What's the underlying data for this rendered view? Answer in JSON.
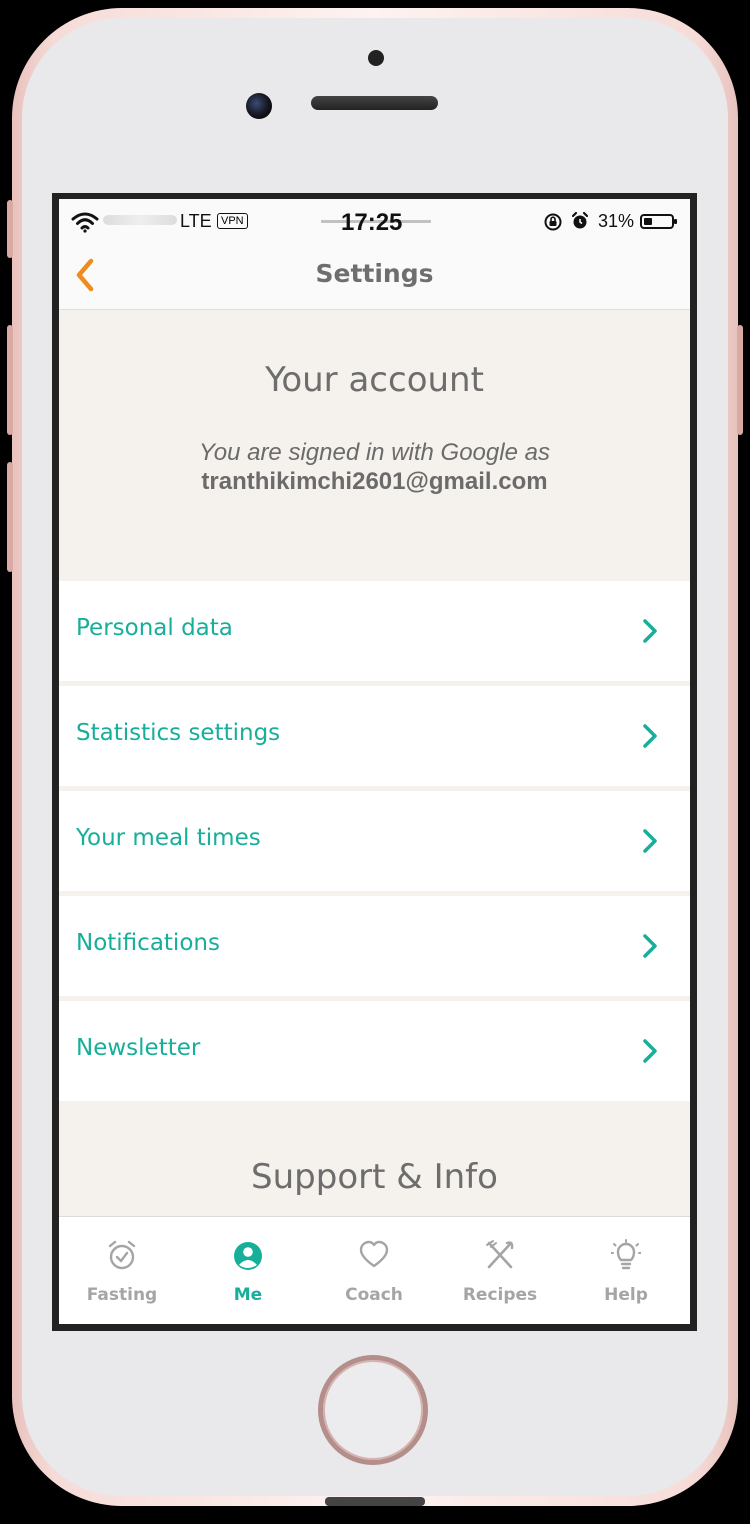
{
  "status_bar": {
    "network": "LTE",
    "vpn": "VPN",
    "time": "17:25",
    "battery": "31%",
    "battery_level": 0.31
  },
  "nav": {
    "title": "Settings",
    "back_icon": "chevron-left-icon"
  },
  "account": {
    "title": "Your account",
    "signed_in_text": "You are signed in with Google as",
    "email": "tranthikimchi2601@gmail.com"
  },
  "menu": {
    "items": [
      {
        "label": "Personal data"
      },
      {
        "label": "Statistics settings"
      },
      {
        "label": "Your meal times"
      },
      {
        "label": "Notifications"
      },
      {
        "label": "Newsletter"
      }
    ]
  },
  "support": {
    "title": "Support & Info"
  },
  "tabbar": {
    "tabs": [
      {
        "label": "Fasting",
        "icon": "alarm-clock-icon"
      },
      {
        "label": "Me",
        "icon": "user-icon",
        "active": true
      },
      {
        "label": "Coach",
        "icon": "heart-icon"
      },
      {
        "label": "Recipes",
        "icon": "cutlery-icon"
      },
      {
        "label": "Help",
        "icon": "lightbulb-icon"
      }
    ]
  },
  "colors": {
    "accent": "#17ae9a",
    "back_arrow": "#f08c1e",
    "section_bg": "#f5f1ec",
    "inactive_tab": "#a5a5a5"
  }
}
